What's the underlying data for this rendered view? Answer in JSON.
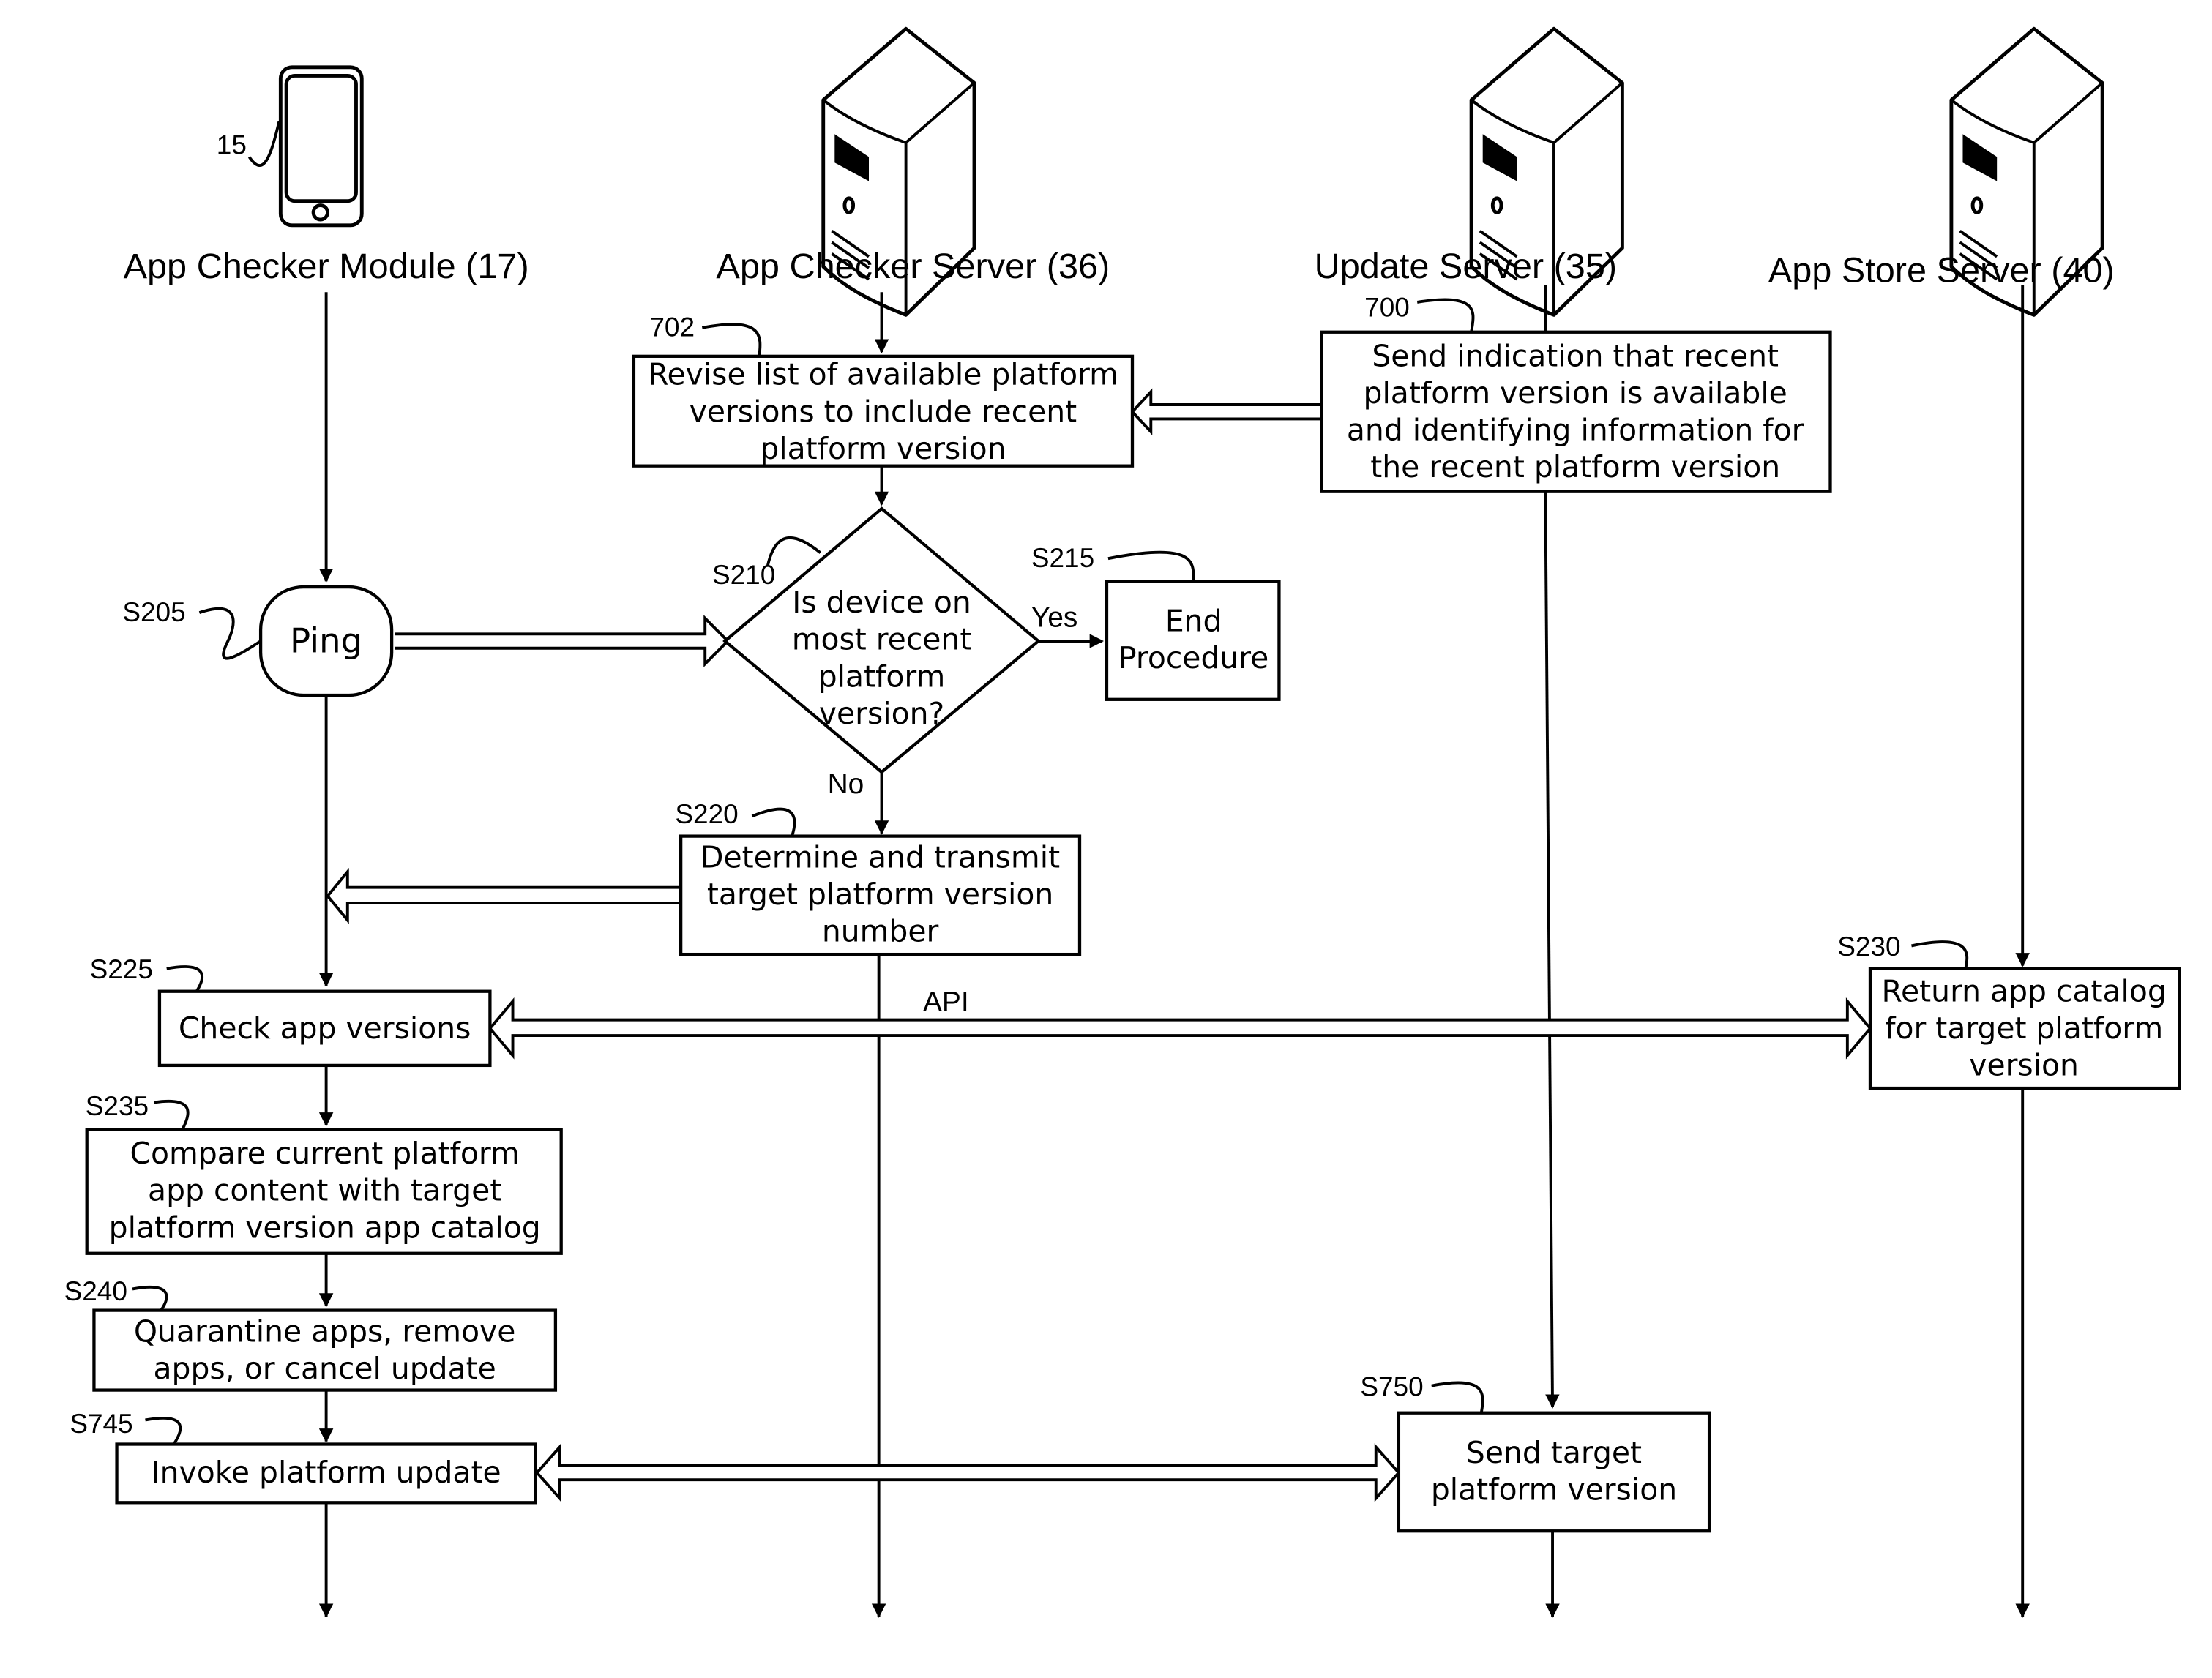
{
  "lanes": [
    {
      "title": "App Checker Module (17)",
      "icon": "smartphone-icon",
      "ref": "15"
    },
    {
      "title": "App Checker Server (36)",
      "icon": "server-icon"
    },
    {
      "title": "Update Server (35)",
      "icon": "server-icon"
    },
    {
      "title": "App Store Server (40)",
      "icon": "server-icon"
    }
  ],
  "steps": {
    "s702": {
      "ref": "702",
      "lines": [
        "Revise list of available platform",
        "versions to include recent",
        "platform version"
      ]
    },
    "s700": {
      "ref": "700",
      "lines": [
        "Send indication that recent",
        "platform version is available",
        "and identifying information for",
        "the recent platform version"
      ]
    },
    "s205": {
      "ref": "S205",
      "lines": [
        "Ping"
      ]
    },
    "s210": {
      "ref": "S210",
      "lines": [
        "Is device on",
        "most recent",
        "platform",
        "version?"
      ]
    },
    "s215": {
      "ref": "S215",
      "lines": [
        "End",
        "Procedure"
      ]
    },
    "s220": {
      "ref": "S220",
      "lines": [
        "Determine and transmit",
        "target platform version",
        "number"
      ]
    },
    "s225": {
      "ref": "S225",
      "lines": [
        "Check app versions"
      ]
    },
    "s230": {
      "ref": "S230",
      "lines": [
        "Return app catalog",
        "for target platform",
        "version"
      ]
    },
    "s235": {
      "ref": "S235",
      "lines": [
        "Compare current platform",
        "app content with target",
        "platform version app catalog"
      ]
    },
    "s240": {
      "ref": "S240",
      "lines": [
        "Quarantine apps, remove",
        "apps, or cancel update"
      ]
    },
    "s745": {
      "ref": "S745",
      "lines": [
        "Invoke platform update"
      ]
    },
    "s750": {
      "ref": "S750",
      "lines": [
        "Send target",
        "platform version"
      ]
    }
  },
  "edge_labels": {
    "yes": "Yes",
    "no": "No",
    "api": "API"
  }
}
